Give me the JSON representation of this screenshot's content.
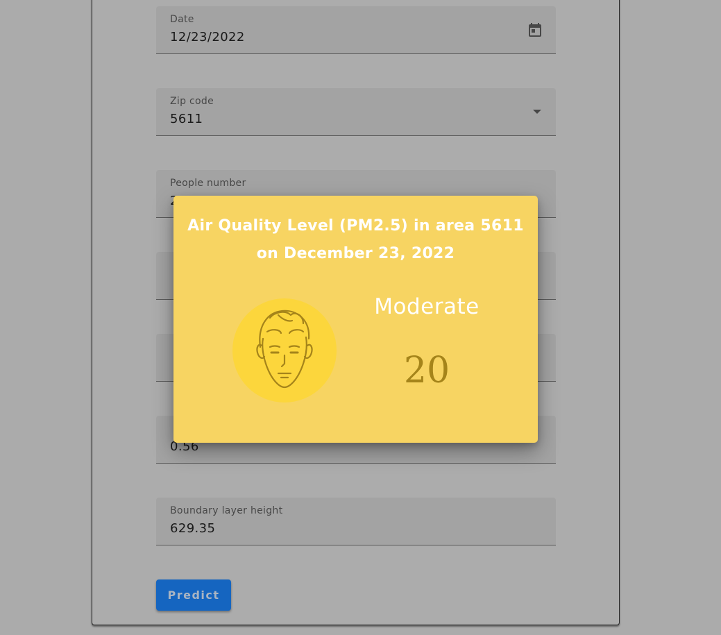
{
  "form": {
    "fields": [
      {
        "label": "Date",
        "value": "12/23/2022"
      },
      {
        "label": "Zip code",
        "value": "5611"
      },
      {
        "label": "People number",
        "value": "2"
      },
      {
        "label": "",
        "value": ""
      },
      {
        "label": "",
        "value": ""
      },
      {
        "label": "",
        "value": "0.56"
      },
      {
        "label": "Boundary layer height",
        "value": "629.35"
      }
    ],
    "predict_label": "Predict"
  },
  "icons": {
    "date": "calendar-icon",
    "zip": "dropdown-arrow-icon",
    "face": "neutral-face-icon"
  },
  "result": {
    "title_line1": "Air Quality Level (PM2.5) in area 5611",
    "title_line2": "on December 23, 2022",
    "level": "Moderate",
    "value": "20"
  },
  "colors": {
    "modal_bg": "#f7d462",
    "face_circle": "#fcd63c",
    "value_text": "#a5841a",
    "button": "#1565c0"
  }
}
